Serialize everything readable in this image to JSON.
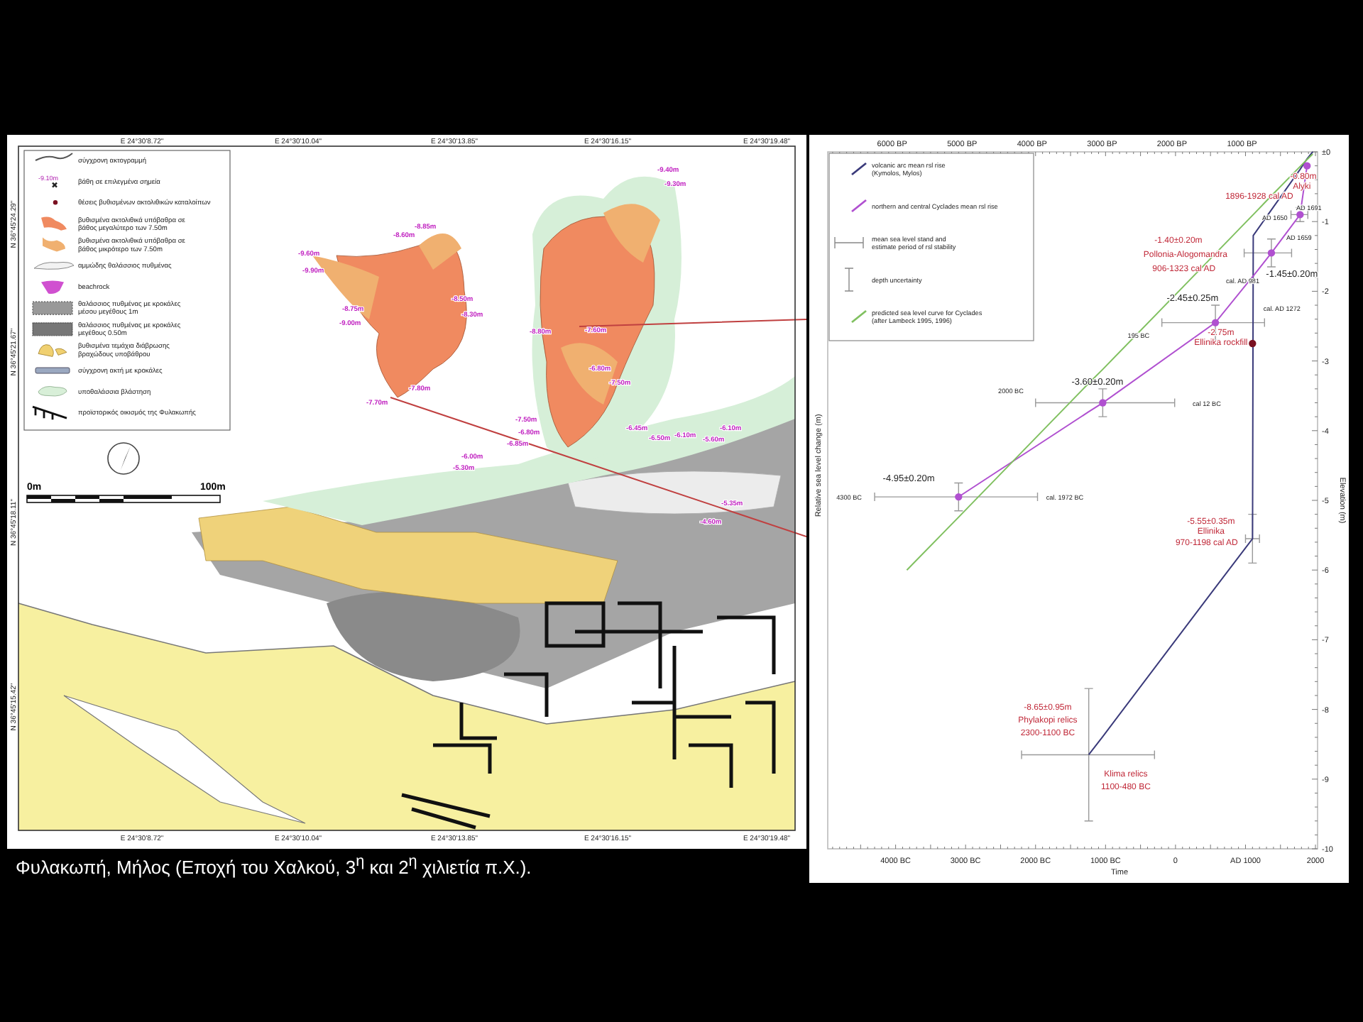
{
  "map": {
    "top_coords": [
      "E 24°30'8.72\"",
      "E 24°30'10.04\"",
      "E 24°30'13.85\"",
      "E 24°30'16.15\"",
      "E 24°30'19.48\""
    ],
    "bottom_coords": [
      "E 24°30'8.72\"",
      "E 24°30'10.04\"",
      "E 24°30'13.85\"",
      "E 24°30'16.15\"",
      "E 24°30'19.48\""
    ],
    "left_coords": [
      "N 36°45'24.29\"",
      "N 36°45'21.67\"",
      "N 36°45'18.11\"",
      "N 36°45'15.42\""
    ],
    "legend": [
      {
        "kind": "coastline",
        "label": "σύγχρονη ακτογραμμή"
      },
      {
        "kind": "depth-point",
        "label": "βάθη σε επιλεγμένα σημεία",
        "sample": "-9.10m"
      },
      {
        "kind": "site-point",
        "label": "θέσεις βυθισμένων ακτολιθικών καταλοίπων"
      },
      {
        "kind": "deep-bedrock",
        "label": "βυθισμένα ακτολιθικά υπόβαθρα σε",
        "label2": "βάθος μεγαλύτερο των 7.50m"
      },
      {
        "kind": "shallow-bedrock",
        "label": "βυθισμένα ακτολιθικά υπόβαθρα σε",
        "label2": "βάθος μικρότερο των 7.50m"
      },
      {
        "kind": "sand",
        "label": "αμμώδης θαλάσσιος πυθμένας"
      },
      {
        "kind": "beachrock",
        "label": "beachrock"
      },
      {
        "kind": "boulders-large",
        "label": "θαλάσσιος πυθμένας με κροκάλες",
        "label2": "μέσου μεγέθους 1m"
      },
      {
        "kind": "boulders-small",
        "label": "θαλάσσιος πυθμένας με κροκάλες",
        "label2": "μεγέθους 0.50m"
      },
      {
        "kind": "eroded-blocks",
        "label": "βυθισμένα τεμάχια διάβρωσης",
        "label2": "βραχώδους υποβάθρου"
      },
      {
        "kind": "pebble-shore",
        "label": "σύγχρονη ακτή με κροκάλες"
      },
      {
        "kind": "vegetation",
        "label": "υποθαλάσσια βλάστηση"
      },
      {
        "kind": "settlement",
        "label": "προϊστορικός οικισμός της Φυλακωπής"
      }
    ],
    "scale": {
      "start": "0m",
      "end": "100m"
    },
    "depth_labels": [
      "-9.40m",
      "-9.30m",
      "-8.85m",
      "-8.60m",
      "-9.60m",
      "-9.90m",
      "-8.75m",
      "-9.00m",
      "-8.50m",
      "-8.30m",
      "-7.80m",
      "-7.70m",
      "-8.80m",
      "-7.60m",
      "-6.80m",
      "-7.50m",
      "-7.50m",
      "-6.80m",
      "-6.85m",
      "-6.45m",
      "-6.50m",
      "-6.10m",
      "-5.60m",
      "-6.10m",
      "-6.00m",
      "-5.30m",
      "-5.35m",
      "-4.60m"
    ]
  },
  "chart": {
    "top_axis_ticks": [
      "6000 BP",
      "5000 BP",
      "4000 BP",
      "3000 BP",
      "2000 BP",
      "1000 BP"
    ],
    "right_axis_title": "Elevation (m)",
    "legend_items": [
      {
        "kind": "range",
        "label": "mean sea level stand and",
        "label2": "estimate period of rsl stability"
      },
      {
        "kind": "depth",
        "label": "depth uncertainty"
      }
    ],
    "chart_data": {
      "type": "line",
      "xlabel": "Time",
      "ylabel": "Relative sea level change (m)",
      "x": [
        -3840,
        -3100,
        -1240,
        -1040,
        570,
        1100,
        1110,
        1370,
        1780,
        1880,
        1960
      ],
      "series": [
        {
          "name": "volcanic arc mean rsl rise (Kymolos, Mylos)",
          "color": "#3a3a7a",
          "values": [
            null,
            null,
            -8.65,
            -8.39,
            -6.25,
            -5.55,
            -1.2,
            -0.83,
            -0.25,
            -0.1,
            0
          ]
        },
        {
          "name": "northern and central Cyclades mean rsl rise",
          "color": "#b050d0",
          "values": [
            null,
            -4.95,
            -3.73,
            -3.6,
            -2.45,
            -1.79,
            -1.78,
            -1.45,
            -0.9,
            -0.2,
            null
          ]
        },
        {
          "name": "predicted sea level curve for Cyclades (after Lambeck 1995, 1996)",
          "color": "#80c060",
          "values": [
            -6.0,
            -5.24,
            -3.32,
            -3.12,
            -1.46,
            -0.91,
            -0.9,
            -0.63,
            -0.21,
            -0.11,
            -0.03
          ]
        },
        {
          "type": "scatter",
          "color": "#b050d0",
          "marker": "circle",
          "values": [
            null,
            -4.95,
            null,
            -3.6,
            -2.45,
            null,
            null,
            -1.45,
            -0.9,
            -0.2,
            null
          ]
        },
        {
          "type": "scatter",
          "color": "#7a1020",
          "marker": "circle",
          "values": [
            null,
            null,
            null,
            null,
            null,
            -2.75,
            null,
            null,
            null,
            null,
            null
          ]
        }
      ],
      "legend": "top-left",
      "xlim": [
        -4970,
        2030
      ],
      "ylim": [
        -10,
        0
      ],
      "xticks": [
        {
          "value": -4000,
          "label": "4000 BC"
        },
        {
          "value": -3000,
          "label": "3000 BC"
        },
        {
          "value": -2000,
          "label": "2000 BC"
        },
        {
          "value": -1000,
          "label": "1000 BC"
        },
        {
          "value": 0,
          "label": "0"
        },
        {
          "value": 1000,
          "label": "AD 1000"
        },
        {
          "value": 2000,
          "label": "2000"
        }
      ],
      "yticks": [
        {
          "value": 0,
          "label": "±0"
        },
        {
          "value": -1,
          "label": "-1"
        },
        {
          "value": -2,
          "label": "-2"
        },
        {
          "value": -3,
          "label": "-3"
        },
        {
          "value": -4,
          "label": "-4"
        },
        {
          "value": -5,
          "label": "-5"
        },
        {
          "value": -6,
          "label": "-6"
        },
        {
          "value": -7,
          "label": "-7"
        },
        {
          "value": -8,
          "label": "-8"
        },
        {
          "value": -9,
          "label": "-9"
        },
        {
          "value": -10,
          "label": "-10"
        }
      ],
      "annotations": [
        "-0.80m",
        "Alyki",
        "1896-1928 cal AD",
        "AD 1691",
        "AD 1650",
        "-1.40±0.20m",
        "Pollonia-Alogomandra",
        "906-1323 cal AD",
        "AD 1659",
        "cal. AD 981",
        "-1.45±0.20m",
        "-2.45±0.25m",
        "cal. AD 1272",
        "195 BC",
        "-2.75m",
        "Ellinika rockfill",
        "-3.60±0.20m",
        "2000 BC",
        "cal 12 BC",
        "-4.95±0.20m",
        "4300 BC",
        "cal. 1972 BC",
        "-5.55±0.35m",
        "Ellinika",
        "970-1198 cal AD",
        "-8.65±0.95m",
        "Phylakopi relics",
        "2300-1100 BC",
        "Klima relics",
        "1100-480 BC"
      ]
    }
  },
  "caption": "Φυλακωπή, Μήλος (Εποχή του Χαλκού, 3$^{η}$ και 2$^{η}$ χιλιετία π.Χ.)."
}
